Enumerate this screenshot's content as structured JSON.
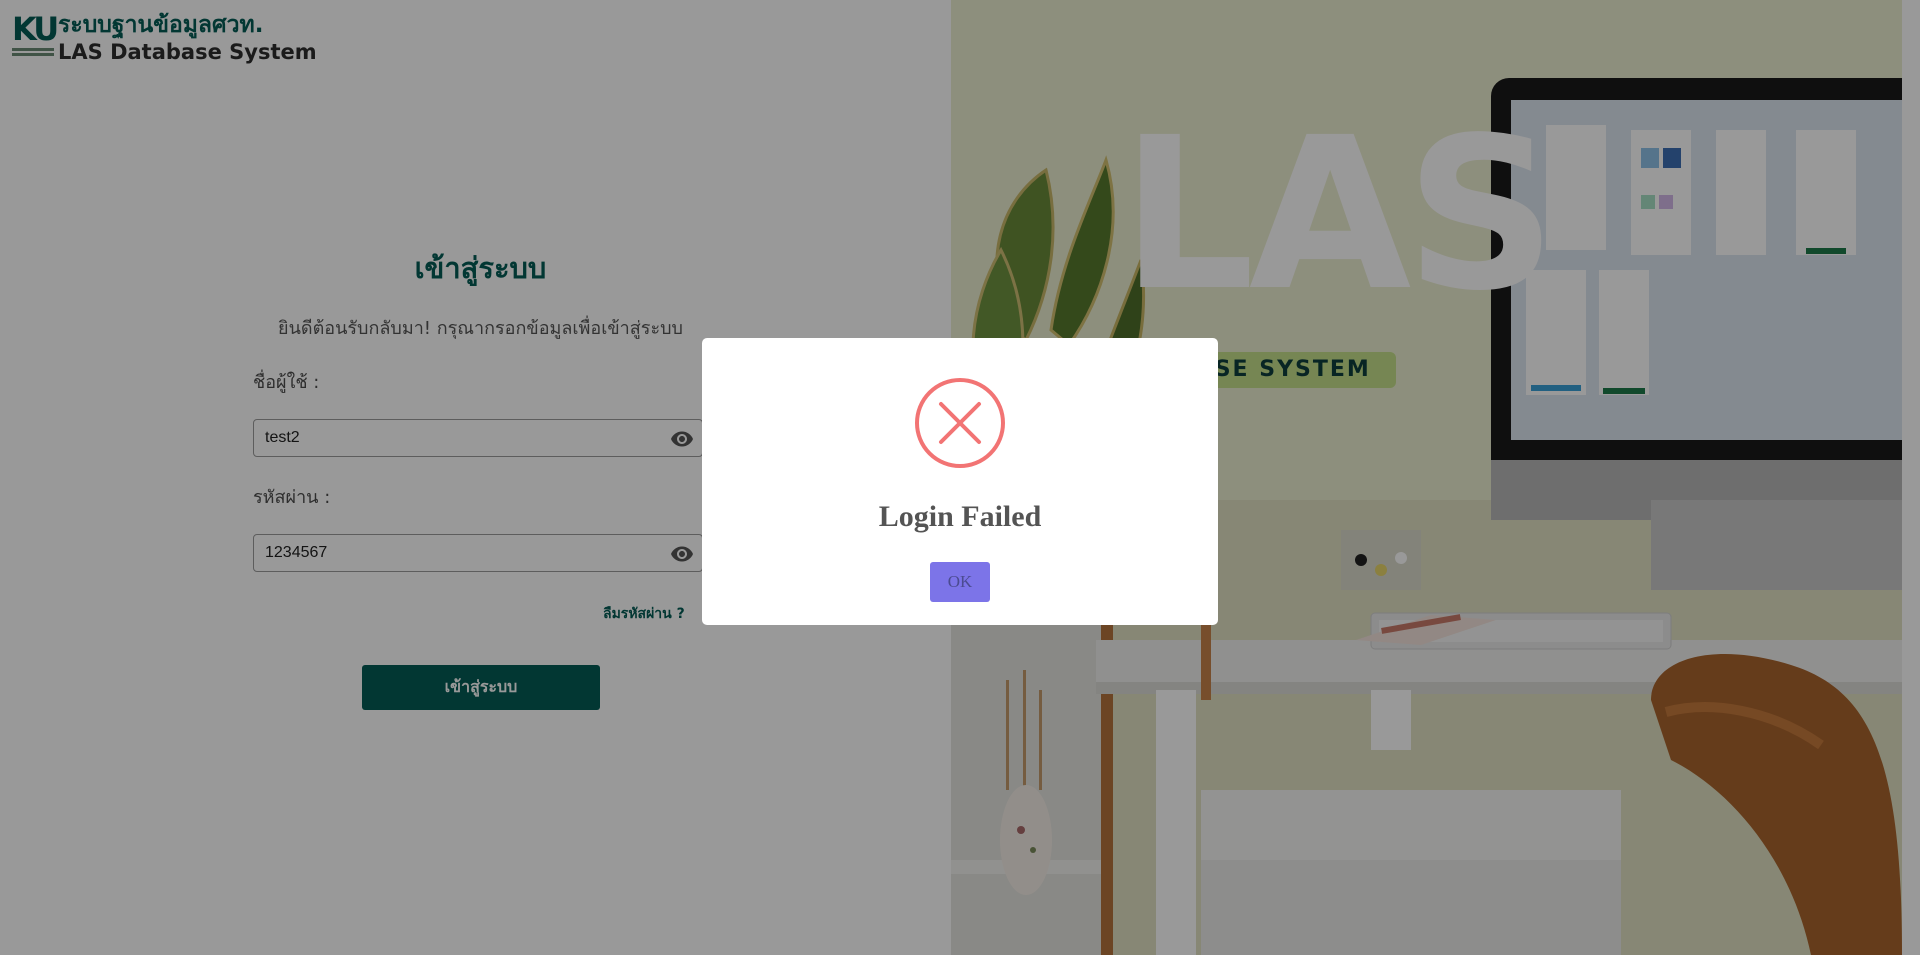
{
  "brand": {
    "logo_text": "KU",
    "title_th": "ระบบฐานข้อมูลศวท.",
    "title_en": "LAS Database System",
    "color": "#045c55"
  },
  "login": {
    "title": "เข้าสู่ระบบ",
    "subtitle": "ยินดีต้อนรับกลับมา! กรุณากรอกข้อมูลเพื่อเข้าสู่ระบบ",
    "username_label": "ชื่อผู้ใช้ :",
    "username_value": "test2",
    "password_label": "รหัสผ่าน :",
    "password_value": "1234567",
    "forgot_label": "ลืมรหัสผ่าน ?",
    "submit_label": "เข้าสู่ระบบ",
    "icons": {
      "username_toggle": "eye-icon",
      "password_toggle": "eye-icon"
    }
  },
  "hero": {
    "title": "LAS",
    "tagline": "DATABASE SYSTEM",
    "tagline_color": "#c5e08a"
  },
  "modal": {
    "icon": "error-x-icon",
    "title": "Login Failed",
    "ok_label": "OK",
    "icon_color": "#f27474",
    "button_color": "#7c74e8"
  }
}
